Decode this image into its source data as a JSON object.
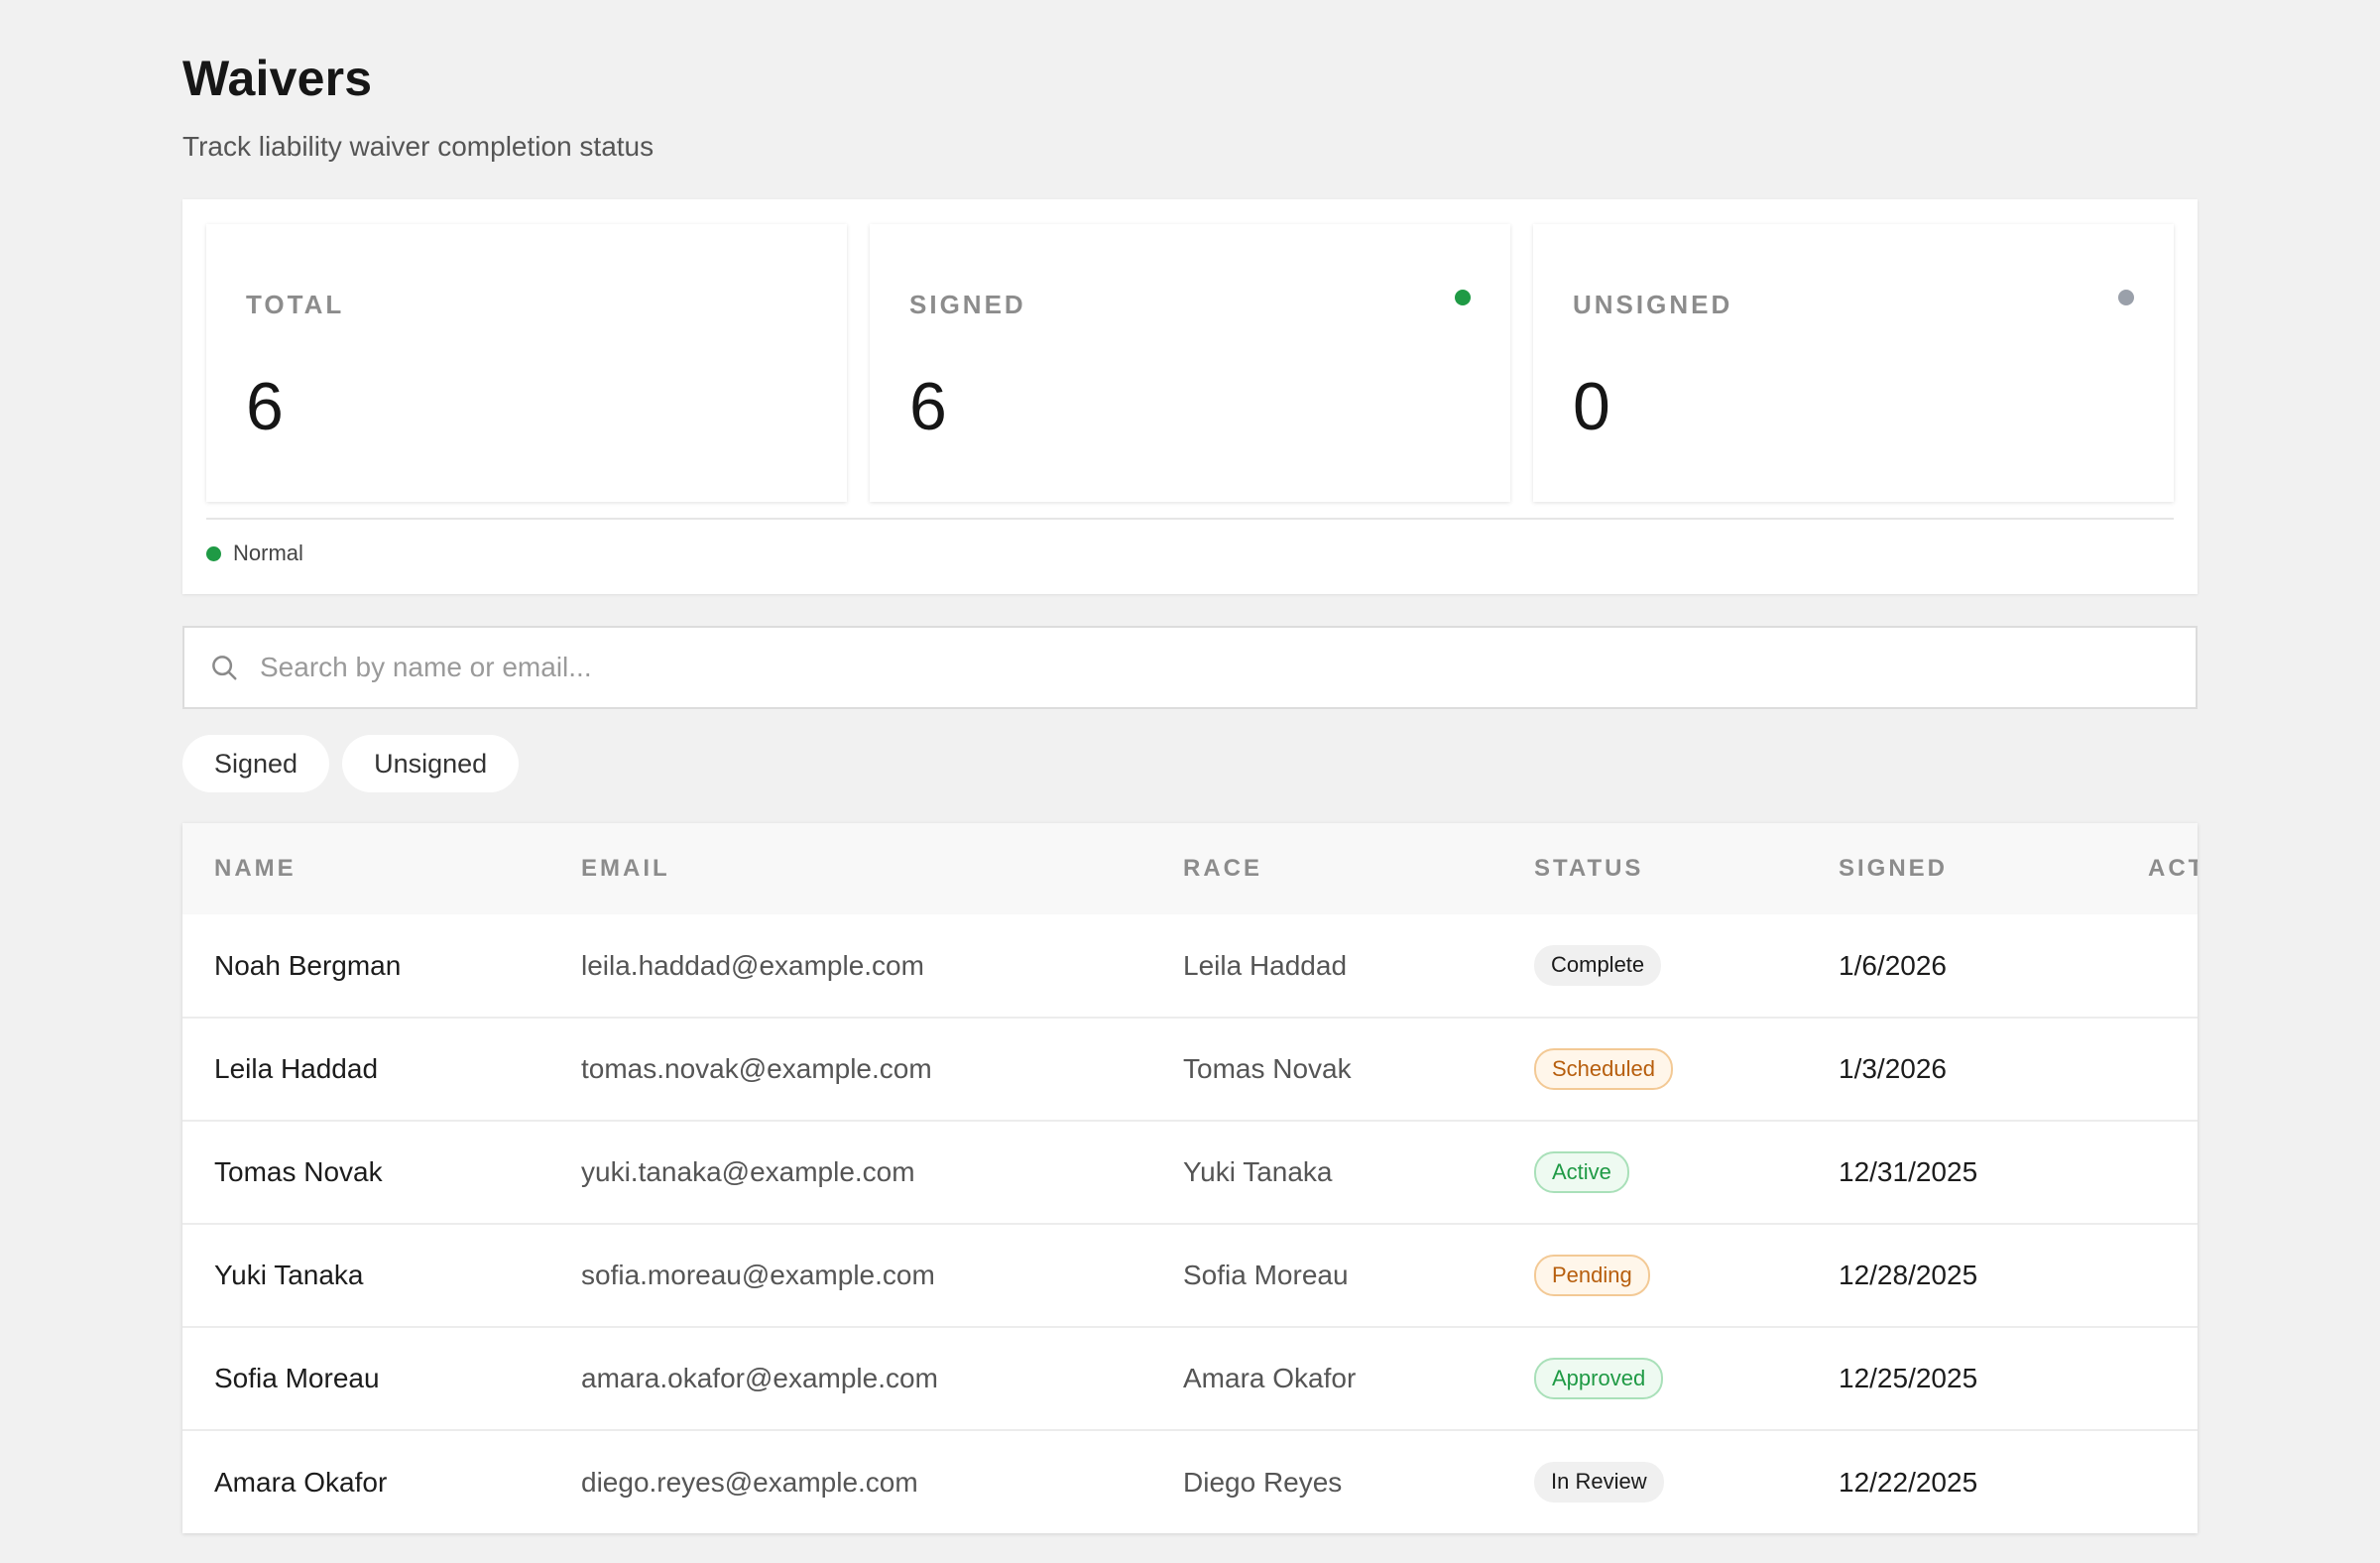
{
  "header": {
    "title": "Waivers",
    "subtitle": "Track liability waiver completion status"
  },
  "stats": {
    "cards": [
      {
        "label": "TOTAL",
        "value": "6"
      },
      {
        "label": "SIGNED",
        "value": "6",
        "dot_color": "#1f9a45"
      },
      {
        "label": "UNSIGNED",
        "value": "0",
        "dot_color": "#9aa0aa"
      }
    ],
    "legend": {
      "label": "Normal",
      "dot_color": "#1f9a45"
    }
  },
  "search": {
    "placeholder": "Search by name or email...",
    "value": "",
    "icon": "search-icon"
  },
  "filters": [
    {
      "label": "Signed"
    },
    {
      "label": "Unsigned"
    }
  ],
  "table": {
    "columns": [
      "NAME",
      "EMAIL",
      "RACE",
      "STATUS",
      "SIGNED",
      "ACTIONS"
    ],
    "rows": [
      {
        "name": "Noah Bergman",
        "email": "leila.haddad@example.com",
        "race": "Leila Haddad",
        "status": "Complete",
        "status_color": "neutral",
        "signed": "1/6/2026"
      },
      {
        "name": "Leila Haddad",
        "email": "tomas.novak@example.com",
        "race": "Tomas Novak",
        "status": "Scheduled",
        "status_color": "orange",
        "signed": "1/3/2026"
      },
      {
        "name": "Tomas Novak",
        "email": "yuki.tanaka@example.com",
        "race": "Yuki Tanaka",
        "status": "Active",
        "status_color": "green",
        "signed": "12/31/2025"
      },
      {
        "name": "Yuki Tanaka",
        "email": "sofia.moreau@example.com",
        "race": "Sofia Moreau",
        "status": "Pending",
        "status_color": "orange",
        "signed": "12/28/2025"
      },
      {
        "name": "Sofia Moreau",
        "email": "amara.okafor@example.com",
        "race": "Amara Okafor",
        "status": "Approved",
        "status_color": "green",
        "signed": "12/25/2025"
      },
      {
        "name": "Amara Okafor",
        "email": "diego.reyes@example.com",
        "race": "Diego Reyes",
        "status": "In Review",
        "status_color": "neutral",
        "signed": "12/22/2025"
      }
    ]
  }
}
